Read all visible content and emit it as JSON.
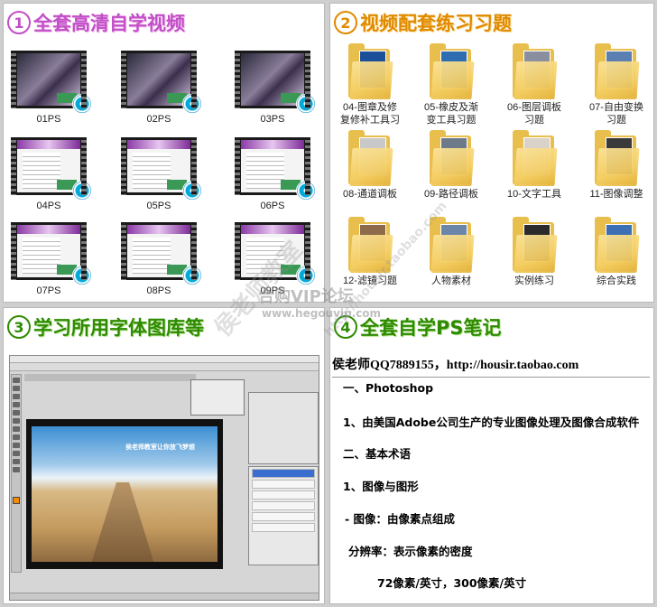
{
  "panel1": {
    "number": "1",
    "title": "全套高清自学视频",
    "videos": [
      {
        "label": "01PS"
      },
      {
        "label": "02PS"
      },
      {
        "label": "03PS"
      },
      {
        "label": "04PS"
      },
      {
        "label": "05PS"
      },
      {
        "label": "06PS"
      },
      {
        "label": "07PS"
      },
      {
        "label": "08PS"
      },
      {
        "label": "09PS"
      }
    ]
  },
  "panel2": {
    "number": "2",
    "title": "视频配套练习习题",
    "folders": [
      {
        "line1": "04-图章及修",
        "line2": "复修补工具习"
      },
      {
        "line1": "05-橡皮及渐",
        "line2": "变工具习题"
      },
      {
        "line1": "06-图层调板",
        "line2": "习题"
      },
      {
        "line1": "07-自由变换",
        "line2": "习题"
      },
      {
        "line1": "08-通道调板",
        "line2": ""
      },
      {
        "line1": "09-路径调板",
        "line2": ""
      },
      {
        "line1": "10-文字工具",
        "line2": ""
      },
      {
        "line1": "11-图像调整",
        "line2": ""
      },
      {
        "line1": "12-滤镜习题",
        "line2": ""
      },
      {
        "line1": "人物素材",
        "line2": ""
      },
      {
        "line1": "实例练习",
        "line2": ""
      },
      {
        "line1": "综合实践",
        "line2": ""
      }
    ]
  },
  "panel3": {
    "number": "3",
    "title": "学习所用字体图库等",
    "canvas_caption": "侯老师教室让你放飞梦想"
  },
  "panel4": {
    "number": "4",
    "title": "全套自学PS笔记",
    "header": "侯老师QQ7889155，http://housir.taobao.com",
    "lines": [
      "一、Photoshop",
      "1、由美国Adobe公司生产的专业图像处理及图像合成软件",
      "二、基本术语",
      "1、图像与图形",
      "- 图像：由像素点组成",
      "分辨率：表示像素的密度",
      "72像素/英寸，300像素/英寸"
    ]
  },
  "watermark": {
    "line1": "合购VIP论坛",
    "line2": "www.hegouvip.com",
    "diag1": "侯老师教室",
    "diag2": "http://housir.taobao.com"
  },
  "colors": {
    "title1": "#c24fc6",
    "title2": "#e08a00",
    "title3": "#2e8b00",
    "title4": "#2e8b00",
    "folder": "#e8bf4d"
  }
}
